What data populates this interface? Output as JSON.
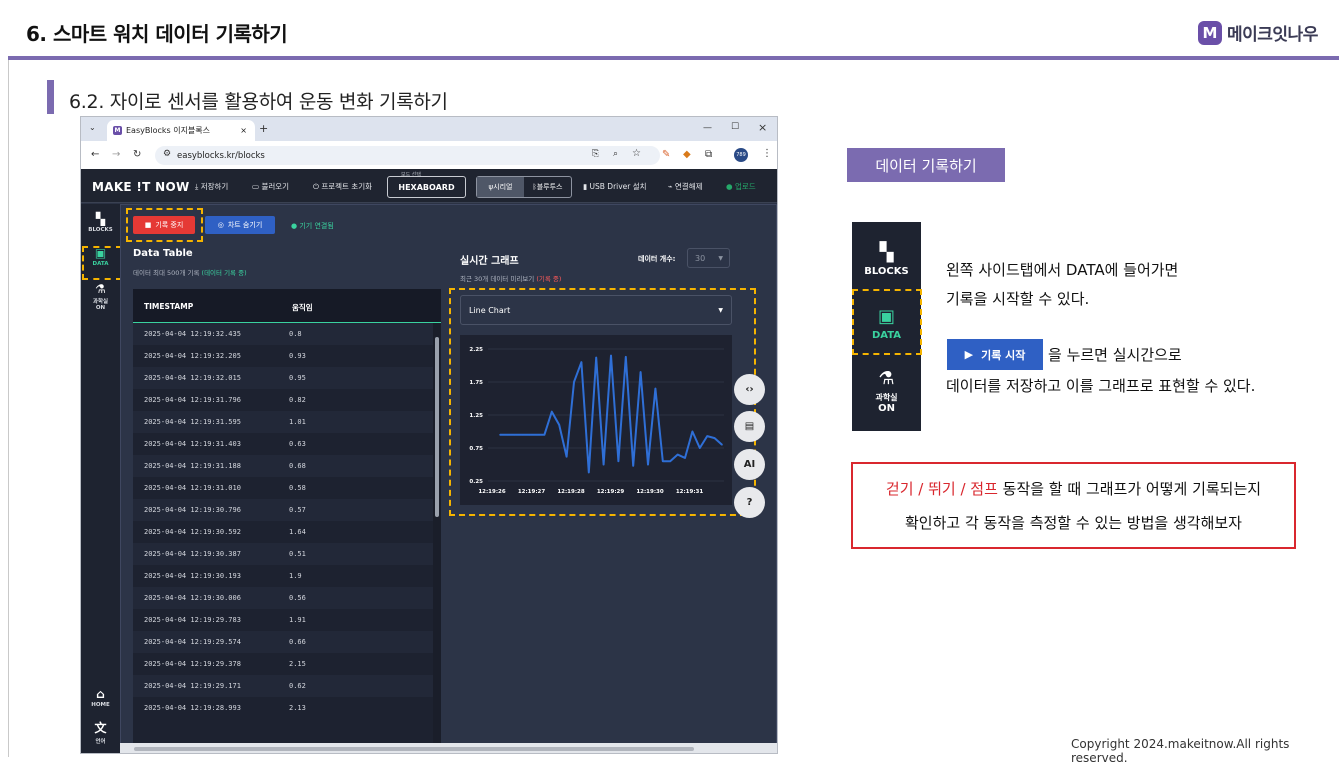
{
  "slide": {
    "title": "6. 스마트 워치 데이터 기록하기",
    "logo_mark": "M",
    "logo_text": "메이크잇나우",
    "subtitle": "6.2. 자이로 센서를 활용하여 운동 변화 기록하기",
    "copyright": "Copyright 2024.makeitnow.All rights reserved."
  },
  "browser": {
    "tab_title": "EasyBlocks 이지블록스",
    "url": "easyblocks.kr/blocks",
    "new_tab": "+",
    "profile": "789"
  },
  "app": {
    "brand": "MAKE !T NOW",
    "nav": {
      "save": "저장하기",
      "load": "불러오기",
      "reset": "프로젝트 초기화",
      "board_caption": "보드 선택",
      "board": "HEXABOARD",
      "serial": "시리얼",
      "bluetooth": "블루투스",
      "usb": "USB Driver 설치",
      "disconnect": "연결해제",
      "upload": "업로드"
    },
    "sidebar": {
      "blocks": "BLOCKS",
      "data": "DATA",
      "lab_line1": "과학실",
      "lab_line2": "ON",
      "home": "HOME",
      "lang": "언어"
    },
    "stop_button": "기록 중지",
    "hide_chart_button": "차트 숨기기",
    "status": "기기 연결됨",
    "data_table": {
      "title": "Data Table",
      "sub_prefix": "데이터 최대 500개 기록",
      "sub_status": "(데이터 기록 중)",
      "col_timestamp": "TIMESTAMP",
      "col_value": "움직임",
      "rows": [
        {
          "t": "2025-04-04 12:19:32.435",
          "v": "0.8"
        },
        {
          "t": "2025-04-04 12:19:32.205",
          "v": "0.93"
        },
        {
          "t": "2025-04-04 12:19:32.015",
          "v": "0.95"
        },
        {
          "t": "2025-04-04 12:19:31.796",
          "v": "0.82"
        },
        {
          "t": "2025-04-04 12:19:31.595",
          "v": "1.01"
        },
        {
          "t": "2025-04-04 12:19:31.403",
          "v": "0.63"
        },
        {
          "t": "2025-04-04 12:19:31.188",
          "v": "0.68"
        },
        {
          "t": "2025-04-04 12:19:31.010",
          "v": "0.58"
        },
        {
          "t": "2025-04-04 12:19:30.796",
          "v": "0.57"
        },
        {
          "t": "2025-04-04 12:19:30.592",
          "v": "1.64"
        },
        {
          "t": "2025-04-04 12:19:30.387",
          "v": "0.51"
        },
        {
          "t": "2025-04-04 12:19:30.193",
          "v": "1.9"
        },
        {
          "t": "2025-04-04 12:19:30.006",
          "v": "0.56"
        },
        {
          "t": "2025-04-04 12:19:29.783",
          "v": "1.91"
        },
        {
          "t": "2025-04-04 12:19:29.574",
          "v": "0.66"
        },
        {
          "t": "2025-04-04 12:19:29.378",
          "v": "2.15"
        },
        {
          "t": "2025-04-04 12:19:29.171",
          "v": "0.62"
        },
        {
          "t": "2025-04-04 12:19:28.993",
          "v": "2.13"
        }
      ]
    },
    "realtime": {
      "title": "실시간 그래프",
      "sub_prefix": "최근 30개 데이터 미리보기",
      "sub_status": "(기록 중)",
      "count_label": "데이터 개수:",
      "count_value": "30",
      "chart_type": "Line Chart",
      "fab_ai": "AI",
      "fab_help": "?"
    }
  },
  "chart_data": {
    "type": "line",
    "color": "#2f6fd6",
    "ylim": [
      0.25,
      2.25
    ],
    "yticks": [
      "2.25",
      "1.75",
      "1.25",
      "0.75",
      "0.25"
    ],
    "xticks": [
      "12:19:26",
      "12:19:27",
      "12:19:28",
      "12:19:29",
      "12:19:30",
      "12:19:31"
    ],
    "values": [
      0.95,
      0.95,
      0.95,
      0.95,
      0.95,
      0.95,
      0.95,
      1.3,
      1.1,
      0.62,
      1.75,
      2.05,
      0.38,
      2.12,
      0.5,
      2.15,
      0.55,
      2.13,
      0.48,
      1.9,
      0.5,
      1.65,
      0.55,
      0.55,
      0.65,
      0.6,
      1.0,
      0.75,
      0.93,
      0.9,
      0.8
    ]
  },
  "panel": {
    "tag": "데이터 기록하기",
    "mini_blocks": "BLOCKS",
    "mini_data": "DATA",
    "mini_lab1": "과학실",
    "mini_lab2": "ON",
    "desc1_line1": "왼쪽 사이드탭에서 DATA에 들어가면",
    "desc1_line2": "기록을 시작할 수 있다.",
    "rec_button": "기록 시작",
    "desc2": "을 누르면 실시간으로",
    "desc3": "데이터를 저장하고 이를 그래프로 표현할 수 있다.",
    "note_red": "걷기 / 뛰기 / 점프",
    "note_rest": " 동작을 할 때 그래프가 어떻게 기록되는지",
    "note_line2": "확인하고 각 동작을 측정할 수 있는 방법을 생각해보자"
  }
}
